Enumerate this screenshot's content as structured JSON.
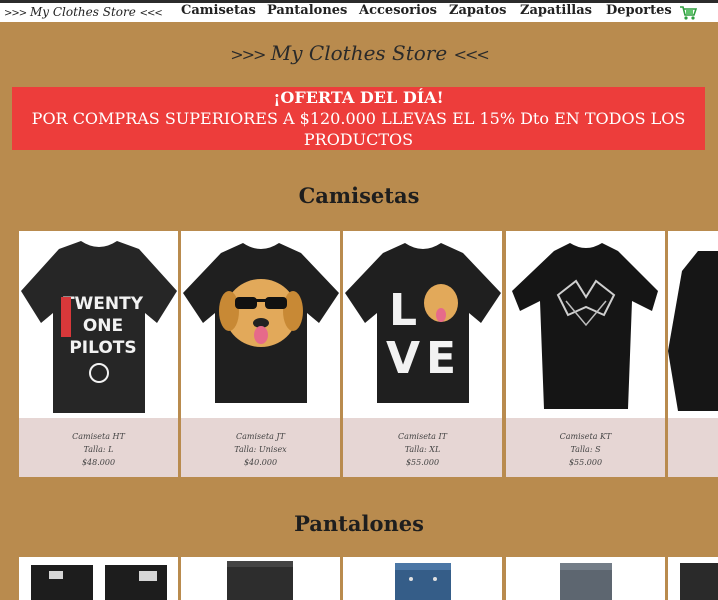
{
  "navbar": {
    "brand": "My Clothes Store",
    "brand_arrows_left": ">>>",
    "brand_arrows_right": "<<<",
    "links": [
      "Camisetas",
      "Pantalones",
      "Accesorios",
      "Zapatos",
      "Zapatillas",
      "Deportes"
    ],
    "cart_icon": "shopping-cart-icon"
  },
  "hero": {
    "title": "My Clothes Store",
    "arrows_left": ">>>",
    "arrows_right": "<<<"
  },
  "offer": {
    "title": "¡OFERTA DEL DÍA!",
    "text": "POR COMPRAS SUPERIORES A $120.000 LLEVAS EL 15% Dto EN TODOS LOS PRODUCTOS"
  },
  "sections": {
    "camisetas": {
      "title": "Camisetas",
      "products": [
        {
          "name": "Camiseta HT",
          "size": "Talla: L",
          "price": "$48.000"
        },
        {
          "name": "Camiseta JT",
          "size": "Talla: Unisex",
          "price": "$40.000"
        },
        {
          "name": "Camiseta IT",
          "size": "Talla: XL",
          "price": "$55.000"
        },
        {
          "name": "Camiseta KT",
          "size": "Talla: S",
          "price": "$55.000"
        }
      ]
    },
    "pantalones": {
      "title": "Pantalones"
    }
  },
  "colors": {
    "background": "#b98b4e",
    "offer": "#ed3d3b",
    "card_info": "#e6d6d4"
  }
}
